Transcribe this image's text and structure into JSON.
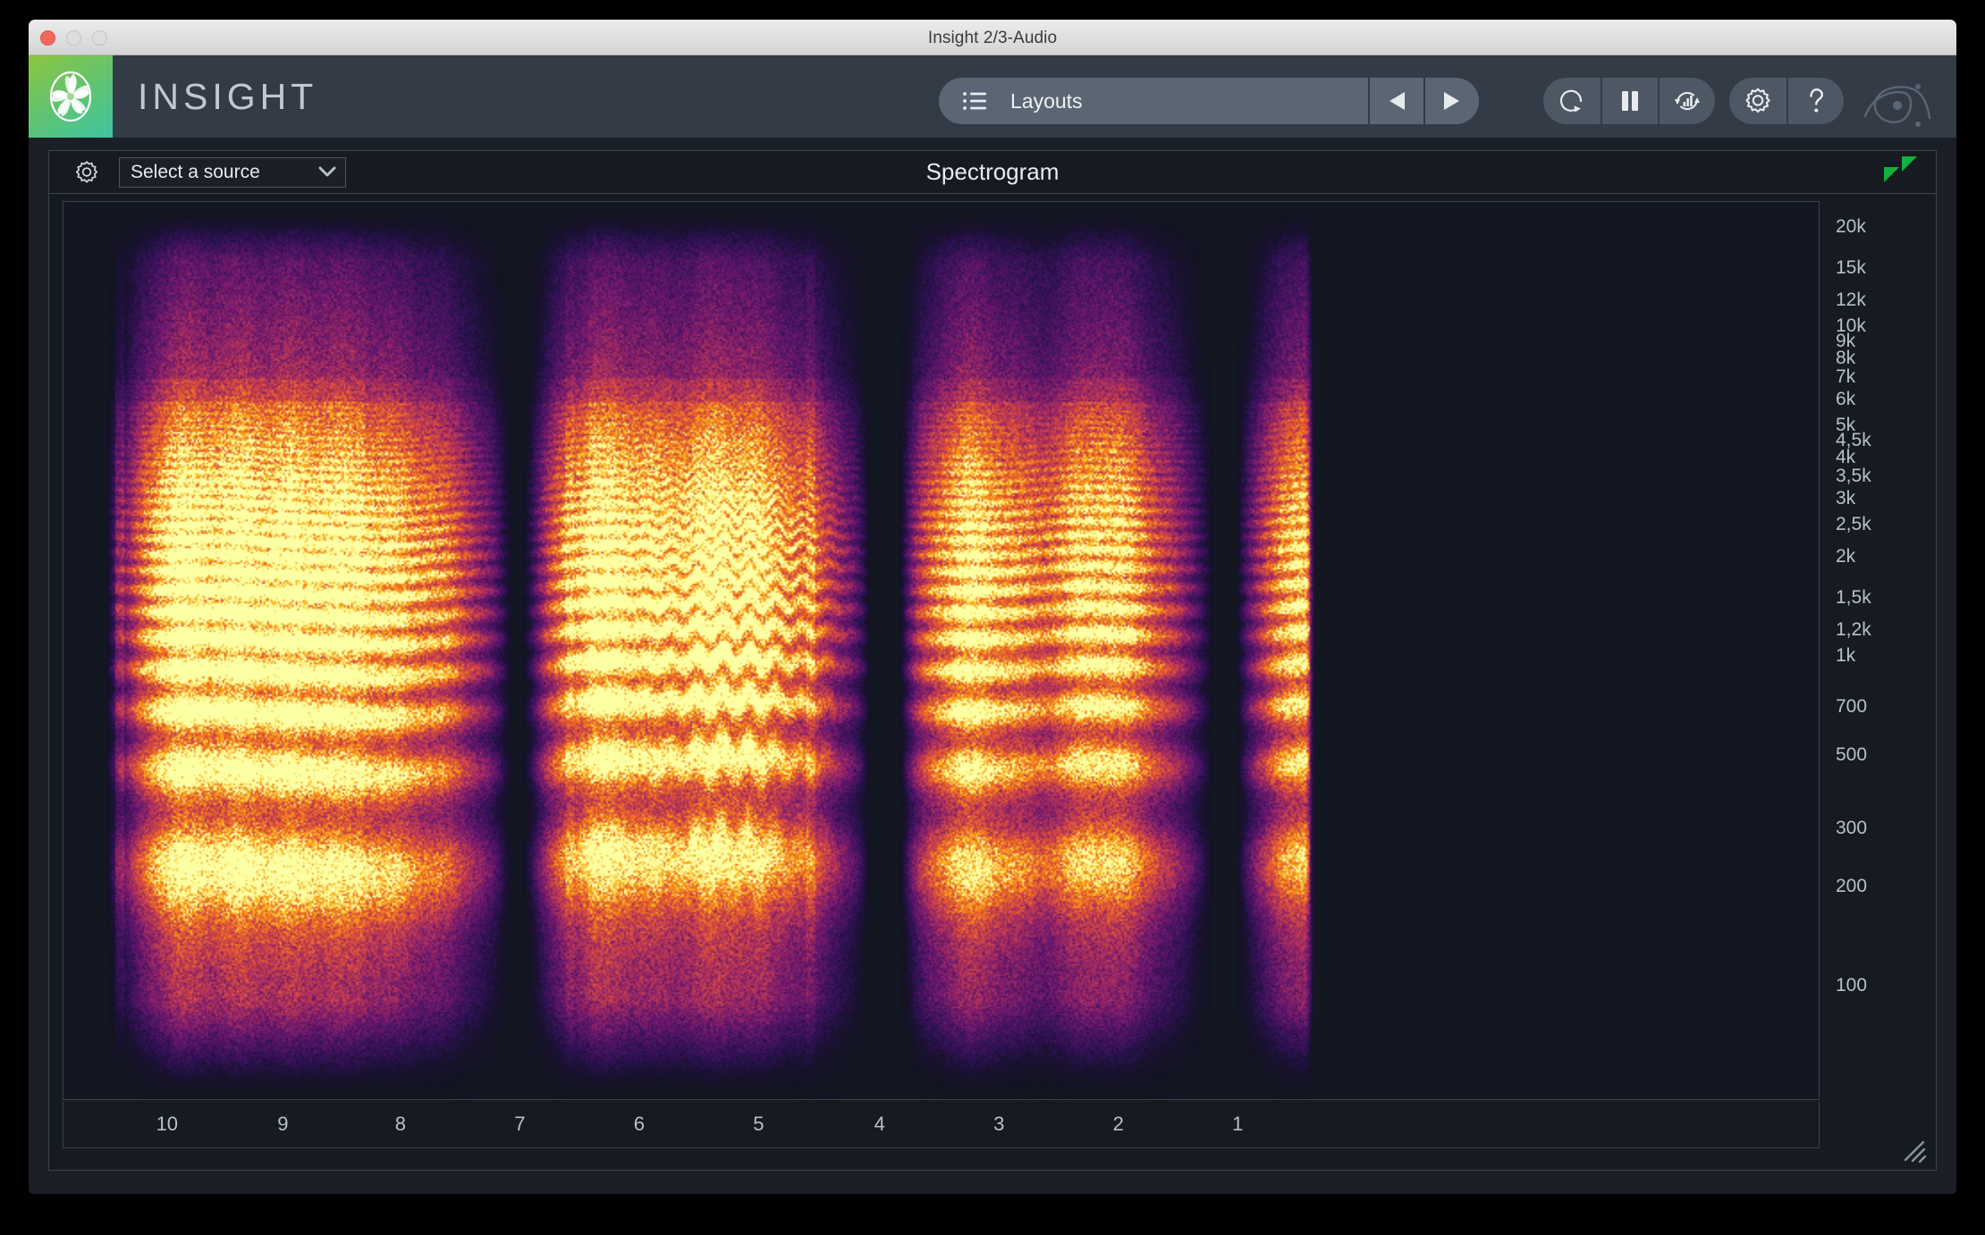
{
  "window": {
    "title": "Insight 2/3-Audio",
    "traffic_lights": [
      "close",
      "minimize",
      "maximize"
    ],
    "close_color": "#f0685c",
    "inactive_color": "#dedede"
  },
  "toolbar": {
    "brand": "INSIGHT",
    "logo_icon": "izotope-spiral-logo",
    "logo_gradient": [
      "#8cc63f",
      "#62c370",
      "#3ec4a0"
    ],
    "layouts": {
      "icon": "list-icon",
      "label": "Layouts",
      "prev_icon": "triangle-left-icon",
      "next_icon": "triangle-right-icon"
    },
    "transport": [
      {
        "name": "reset-button",
        "icon": "circular-arrow-reset-icon"
      },
      {
        "name": "pause-button",
        "icon": "pause-icon"
      },
      {
        "name": "auto-scale-button",
        "icon": "refresh-meter-icon"
      }
    ],
    "utility": [
      {
        "name": "settings-button",
        "icon": "gear-icon"
      },
      {
        "name": "help-button",
        "icon": "question-mark-icon"
      }
    ],
    "izotope_mark": "izotope-waveform-mark",
    "bg_color": "#333b47",
    "pill_color": "#5a6673"
  },
  "panel": {
    "source_gear_icon": "gear-icon",
    "source_select": {
      "value": "Select a source",
      "chevron_icon": "chevron-down-icon"
    },
    "title": "Spectrogram",
    "expand_indicator_icon": "green-double-triangle-icon",
    "expand_indicator_color": "#12b33f",
    "resize_grip_icon": "resize-grip-icon"
  },
  "chart_data": {
    "type": "heatmap",
    "title": "Spectrogram",
    "xlabel": "",
    "ylabel": "",
    "x_tick_labels": [
      "10",
      "9",
      "8",
      "7",
      "6",
      "5",
      "4",
      "3",
      "2",
      "1"
    ],
    "x_tick_positions_pct": [
      5.9,
      12.5,
      19.2,
      26.0,
      32.8,
      39.6,
      46.5,
      53.3,
      60.1,
      66.9
    ],
    "x_axis_unit": "seconds",
    "x_axis_direction": "older-to-newer-right",
    "y_tick_labels": [
      "20k",
      "15k",
      "12k",
      "10k",
      "9k",
      "8k",
      "7k",
      "6k",
      "5k",
      "4,5k",
      "4k",
      "3,5k",
      "3k",
      "2,5k",
      "2k",
      "1,5k",
      "1,2k",
      "1k",
      "700",
      "500",
      "300",
      "200",
      "100"
    ],
    "y_tick_values_hz": [
      20000,
      15000,
      12000,
      10000,
      9000,
      8000,
      7000,
      6000,
      5000,
      4500,
      4000,
      3500,
      3000,
      2500,
      2000,
      1500,
      1200,
      1000,
      700,
      500,
      300,
      200,
      100
    ],
    "y_scale": "log",
    "y_range_hz": [
      45,
      24000
    ],
    "grid": false,
    "legend_position": "none",
    "colormap": "inferno",
    "colormap_stops": [
      "#0b0a16",
      "#2c1152",
      "#6a176e",
      "#a52c60",
      "#d44842",
      "#f1711f",
      "#fbb41a",
      "#fcffa4"
    ],
    "background_color": "#131722",
    "description": "Live audio spectrogram of sustained vocal/speech content with strong harmonic stacks below 2 kHz and broadband transients",
    "events": [
      {
        "center_pct": 6.0,
        "width_pct": 3.0,
        "kind": "onset-transient",
        "strength": 0.78
      },
      {
        "center_pct": 10.5,
        "width_pct": 5.5,
        "kind": "harmonic-stack",
        "f0_hz": 230,
        "strength": 0.95
      },
      {
        "center_pct": 17.5,
        "width_pct": 8.0,
        "kind": "harmonic-stack",
        "f0_hz": 215,
        "strength": 0.9
      },
      {
        "center_pct": 26.0,
        "width_pct": 2.0,
        "kind": "gap",
        "strength": 0.1
      },
      {
        "center_pct": 31.0,
        "width_pct": 5.0,
        "kind": "harmonic-stack",
        "f0_hz": 245,
        "strength": 0.92
      },
      {
        "center_pct": 38.5,
        "width_pct": 7.0,
        "kind": "vibrato-stack",
        "f0_hz": 250,
        "strength": 1.0
      },
      {
        "center_pct": 47.0,
        "width_pct": 2.0,
        "kind": "gap",
        "strength": 0.12
      },
      {
        "center_pct": 52.0,
        "width_pct": 5.0,
        "kind": "harmonic-stack",
        "f0_hz": 225,
        "strength": 0.88
      },
      {
        "center_pct": 59.5,
        "width_pct": 5.0,
        "kind": "harmonic-stack",
        "f0_hz": 235,
        "strength": 0.86
      },
      {
        "center_pct": 66.5,
        "width_pct": 2.0,
        "kind": "gap",
        "strength": 0.1
      },
      {
        "center_pct": 72.0,
        "width_pct": 6.0,
        "kind": "harmonic-stack",
        "f0_hz": 240,
        "strength": 0.93
      }
    ]
  }
}
